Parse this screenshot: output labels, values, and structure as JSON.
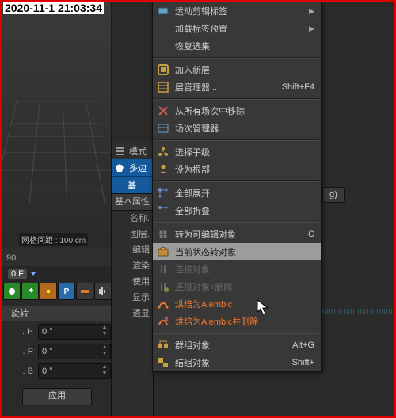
{
  "timestamp": "2020-11-1 21:03:34",
  "viewport": {
    "grid_label": "网格间距 : 100 cm"
  },
  "timeline": {
    "t1": "90",
    "cur": "0 F"
  },
  "icon_letter": "P",
  "panel": {
    "header": "旋转",
    "rows": [
      {
        "label": ". H",
        "value": "0 °"
      },
      {
        "label": ". P",
        "value": "0 °"
      },
      {
        "label": ". B",
        "value": "0 °"
      }
    ],
    "apply": "应用"
  },
  "sidecol": {
    "mode_tab": "模式",
    "poly_tab": "多边",
    "base_tab": "基",
    "section": "基本属性",
    "labels": [
      "名称.",
      "图层.",
      "编辑",
      "渲染",
      "使用",
      "显示",
      "透显"
    ]
  },
  "menu": {
    "items": [
      {
        "label": "运动剪辑标签",
        "sub": true
      },
      {
        "label": "加载标签预置",
        "sub": true
      },
      {
        "label": "恢复选集"
      },
      null,
      {
        "label": "加入新层"
      },
      {
        "label": "层管理器...",
        "shortcut": "Shift+F4"
      },
      null,
      {
        "label": "从所有场次中移除"
      },
      {
        "label": "场次管理器..."
      },
      null,
      {
        "label": "选择子级"
      },
      {
        "label": "设为根部"
      },
      null,
      {
        "label": "全部展开"
      },
      {
        "label": "全部折叠"
      },
      null,
      {
        "label": "转为可编辑对象",
        "shortcut": "C"
      },
      {
        "label": "当前状态转对象",
        "hover": true
      },
      {
        "label": "连接对象",
        "disabled": true
      },
      {
        "label": "连接对象+删除",
        "disabled": true
      },
      {
        "label": "烘焙为Alembic",
        "color": "#f07830"
      },
      {
        "label": "烘焙为Alembic并删除",
        "color": "#f07830"
      },
      null,
      {
        "label": "群组对象",
        "shortcut": "Alt+G"
      },
      {
        "label": "结组对象",
        "shortcut": "Shift+"
      }
    ]
  },
  "rightpanel": {
    "tab": "g)"
  }
}
